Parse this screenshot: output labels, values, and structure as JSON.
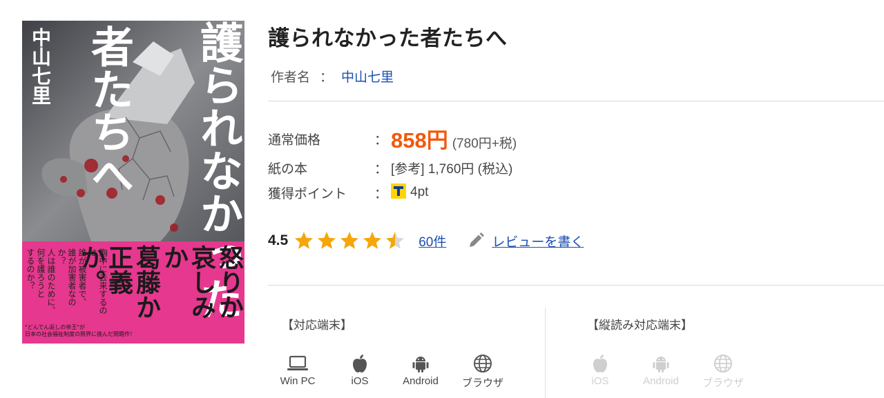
{
  "book": {
    "title": "護られなかった者たちへ",
    "author_label": "作者名",
    "author_sep": "：",
    "author_name": "中山七里"
  },
  "cover": {
    "author_text": "中山七里",
    "title_line1": "護られなかった",
    "title_line2": "者たちへ",
    "band_text_col1": "怒りか",
    "band_text_col2": "哀しみか",
    "band_text_col3": "葛藤か",
    "band_text_col4": "正義か。",
    "band_sub1": "胸中に去来するのは、",
    "band_sub2": "誰が被害者で、",
    "band_sub3": "誰が加害者なのか？",
    "band_sub4": "人は誰のために、",
    "band_sub5": "何を護ろうと",
    "band_sub6": "するのか？",
    "tagline1": "\"どんでん返しの帝王\"が",
    "tagline2": "日本の社会福祉制度の限界に挑んだ問題作！"
  },
  "price": {
    "regular_label": "通常価格",
    "colon": "：",
    "regular_value": "858円",
    "regular_note": "(780円+税)",
    "paper_label": "紙の本",
    "paper_value": "[参考] 1,760円 (税込)",
    "points_label": "獲得ポイント",
    "points_value": "4pt"
  },
  "rating": {
    "score": "4.5",
    "stars": 4.5,
    "count": "60件",
    "review_link": "レビューを書く"
  },
  "devices": {
    "supported_label": "【対応端末】",
    "vertical_label": "【縦読み対応端末】",
    "supported": [
      {
        "name": "Win PC",
        "icon": "laptop-icon"
      },
      {
        "name": "iOS",
        "icon": "apple-icon"
      },
      {
        "name": "Android",
        "icon": "android-icon"
      },
      {
        "name": "ブラウザ",
        "icon": "globe-icon"
      }
    ],
    "vertical": [
      {
        "name": "iOS",
        "icon": "apple-icon"
      },
      {
        "name": "Android",
        "icon": "android-icon"
      },
      {
        "name": "ブラウザ",
        "icon": "globe-icon"
      }
    ]
  },
  "colors": {
    "price": "#f2580c",
    "link": "#1a4fb0",
    "star": "#f6a609",
    "band": "#e5388e"
  }
}
